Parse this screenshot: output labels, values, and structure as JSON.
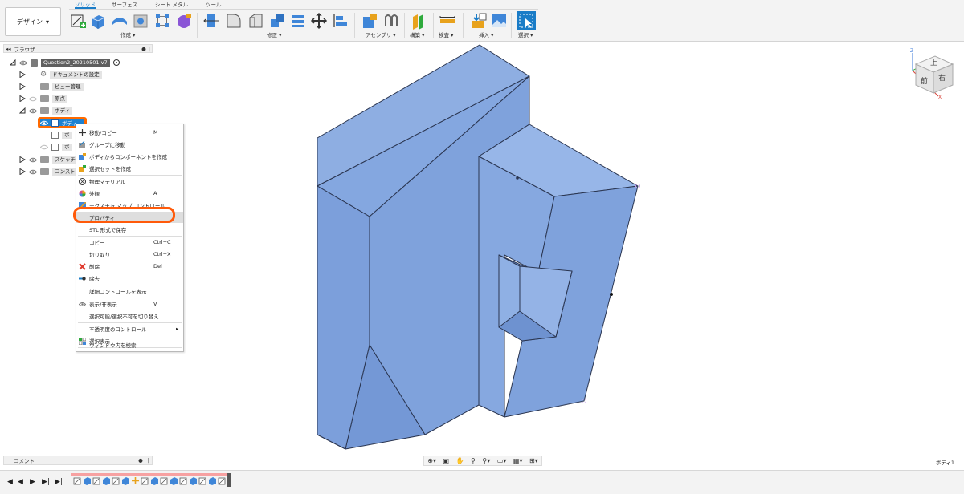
{
  "toolbar": {
    "design_button": "デザイン",
    "tabs": [
      "ソリッド",
      "サーフェス",
      "シート メタル",
      "ツール"
    ],
    "groups": {
      "create": "作成",
      "modify": "修正",
      "assemble": "アセンブリ",
      "construct": "構築",
      "inspect": "検査",
      "insert": "挿入",
      "select": "選択"
    }
  },
  "browser": {
    "title": "ブラウザ",
    "document": "Question2_20210501 v7",
    "nodes": {
      "doc_settings": "ドキュメントの設定",
      "named_views": "ビュー管理",
      "origin": "原点",
      "bodies": "ボディ",
      "body_selected": "ボディ",
      "body2": "ボ",
      "body3": "ボ",
      "sketches": "スケッチ",
      "constructions": "コンストラ"
    }
  },
  "context_menu": {
    "items": [
      {
        "label": "移動/コピー",
        "shortcut": "M",
        "icon": "move-icon"
      },
      {
        "label": "グループに移動",
        "shortcut": "",
        "icon": "group-move-icon"
      },
      {
        "label": "ボディからコンポーネントを作成",
        "shortcut": "",
        "icon": "component-icon"
      },
      {
        "label": "選択セットを作成",
        "shortcut": "",
        "icon": "selection-set-icon"
      },
      {
        "label": "物理マテリアル",
        "shortcut": "",
        "icon": "material-icon"
      },
      {
        "label": "外観",
        "shortcut": "A",
        "icon": "appearance-icon"
      },
      {
        "label": "テクスチャ マップ コントロール",
        "shortcut": "",
        "icon": "texture-icon"
      },
      {
        "label": "プロパティ",
        "shortcut": "",
        "icon": ""
      },
      {
        "label": "STL 形式で保存",
        "shortcut": "",
        "icon": ""
      },
      {
        "label": "コピー",
        "shortcut": "Ctrl+C",
        "icon": ""
      },
      {
        "label": "切り取り",
        "shortcut": "Ctrl+X",
        "icon": ""
      },
      {
        "label": "削除",
        "shortcut": "Del",
        "icon": "delete-icon"
      },
      {
        "label": "除去",
        "shortcut": "",
        "icon": "remove-icon"
      },
      {
        "label": "詳細コントロールを表示",
        "shortcut": "",
        "icon": ""
      },
      {
        "label": "表示/非表示",
        "shortcut": "V",
        "icon": "eye-icon"
      },
      {
        "label": "選択可能/選択不可を切り替え",
        "shortcut": "",
        "icon": ""
      },
      {
        "label": "不透明度のコントロール",
        "shortcut": "",
        "icon": ""
      },
      {
        "label": "選択表示",
        "shortcut": "",
        "icon": "isolate-icon"
      },
      {
        "label": "ウィンドウ内を検索",
        "shortcut": "",
        "icon": ""
      }
    ]
  },
  "comments": {
    "label": "コメント"
  },
  "viewcube": {
    "top": "上",
    "front": "前",
    "right": "右",
    "axis_x": "X",
    "axis_z": "Z"
  },
  "status": {
    "selection": "ボディ1"
  },
  "colors": {
    "accent": "#1a7cc7",
    "highlight_annotation": "#ff5a0a",
    "model_face": "#7ea2dc",
    "model_face_light": "#9ab8e8",
    "model_face_dark": "#6d93d0"
  }
}
